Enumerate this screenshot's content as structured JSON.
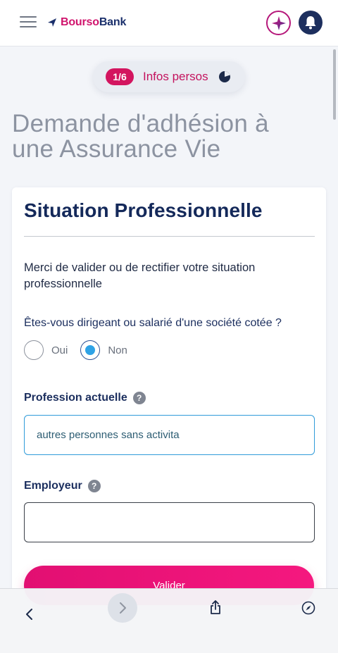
{
  "header": {
    "brand_part1": "Bourso",
    "brand_part2": "Bank",
    "colors": {
      "brand_pink": "#d0156d",
      "brand_navy": "#1a2f6b"
    }
  },
  "stepper": {
    "badge": "1/6",
    "label": "Infos persos",
    "progress": 0.1667
  },
  "page": {
    "title_line1": "Demande d'adhésion à",
    "title_line2": "une Assurance Vie"
  },
  "form": {
    "section_title": "Situation Professionnelle",
    "intro": "Merci de valider ou de rectifier votre situation professionnelle",
    "question": "Êtes-vous dirigeant ou salarié d'une société cotée ?",
    "options": [
      {
        "label": "Oui",
        "selected": false
      },
      {
        "label": "Non",
        "selected": true
      }
    ],
    "profession": {
      "label": "Profession actuelle",
      "value": "autres personnes sans activita"
    },
    "employer": {
      "label": "Employeur",
      "value": ""
    },
    "submit_label": "Valider",
    "help_glyph": "?"
  },
  "browser": {
    "icons": [
      "back-icon",
      "forward-icon",
      "share-icon",
      "compass-icon"
    ]
  },
  "colors": {
    "accent": "#e20f72",
    "radio_selected": "#2ea2e6",
    "title_gray": "#8c93a1"
  }
}
